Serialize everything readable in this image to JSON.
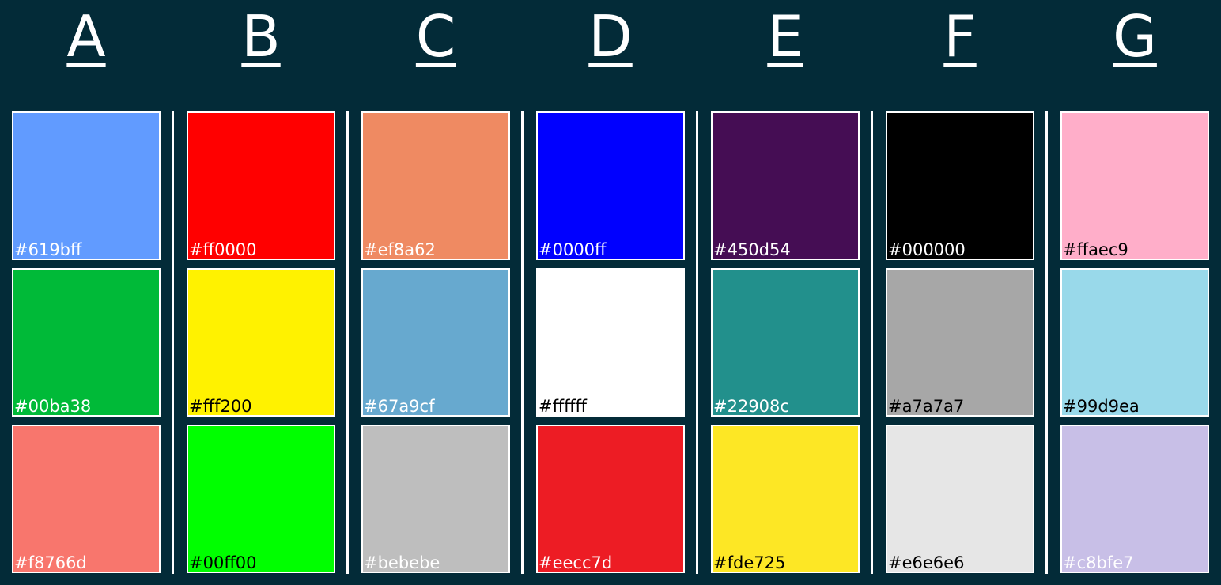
{
  "page": {
    "background": "#032b38"
  },
  "columns": [
    {
      "letter": "A",
      "swatches": [
        {
          "hex": "#619bff",
          "label": "#619bff",
          "label_color": "#ffffff"
        },
        {
          "hex": "#00ba38",
          "label": "#00ba38",
          "label_color": "#ffffff"
        },
        {
          "hex": "#f8766d",
          "label": "#f8766d",
          "label_color": "#ffffff"
        }
      ]
    },
    {
      "letter": "B",
      "swatches": [
        {
          "hex": "#ff0000",
          "label": "#ff0000",
          "label_color": "#ffffff"
        },
        {
          "hex": "#fff200",
          "label": "#fff200",
          "label_color": "#000000"
        },
        {
          "hex": "#00ff00",
          "label": "#00ff00",
          "label_color": "#000000"
        }
      ]
    },
    {
      "letter": "C",
      "swatches": [
        {
          "hex": "#ef8a62",
          "label": "#ef8a62",
          "label_color": "#ffffff"
        },
        {
          "hex": "#67a9cf",
          "label": "#67a9cf",
          "label_color": "#ffffff"
        },
        {
          "hex": "#bebebe",
          "label": "#bebebe",
          "label_color": "#ffffff"
        }
      ]
    },
    {
      "letter": "D",
      "swatches": [
        {
          "hex": "#0000ff",
          "label": "#0000ff",
          "label_color": "#ffffff"
        },
        {
          "hex": "#ffffff",
          "label": "#ffffff",
          "label_color": "#000000"
        },
        {
          "hex": "#ed1c24",
          "label": "#eecc7d",
          "label_color": "#ffffff"
        }
      ]
    },
    {
      "letter": "E",
      "swatches": [
        {
          "hex": "#450d54",
          "label": "#450d54",
          "label_color": "#ffffff"
        },
        {
          "hex": "#22908c",
          "label": "#22908c",
          "label_color": "#ffffff"
        },
        {
          "hex": "#fde725",
          "label": "#fde725",
          "label_color": "#000000"
        }
      ]
    },
    {
      "letter": "F",
      "swatches": [
        {
          "hex": "#000000",
          "label": "#000000",
          "label_color": "#ffffff"
        },
        {
          "hex": "#a7a7a7",
          "label": "#a7a7a7",
          "label_color": "#000000"
        },
        {
          "hex": "#e6e6e6",
          "label": "#e6e6e6",
          "label_color": "#000000"
        }
      ]
    },
    {
      "letter": "G",
      "swatches": [
        {
          "hex": "#ffaec9",
          "label": "#ffaec9",
          "label_color": "#000000"
        },
        {
          "hex": "#99d9ea",
          "label": "#99d9ea",
          "label_color": "#000000"
        },
        {
          "hex": "#c8bfe7",
          "label": "#c8bfe7",
          "label_color": "#ffffff"
        }
      ]
    }
  ]
}
